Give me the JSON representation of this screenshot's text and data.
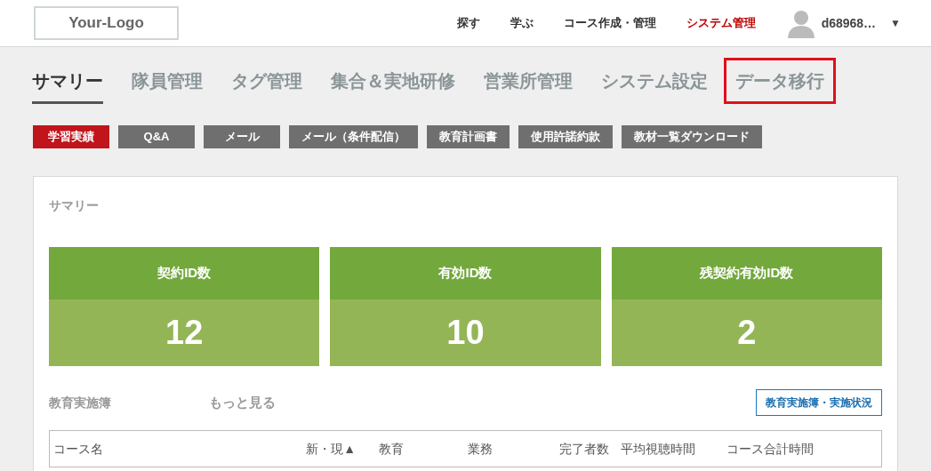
{
  "header": {
    "logo": "Your-Logo",
    "nav": [
      {
        "label": "探す",
        "selected": false
      },
      {
        "label": "学ぶ",
        "selected": false
      },
      {
        "label": "コース作成・管理",
        "selected": false
      },
      {
        "label": "システム管理",
        "selected": true
      }
    ],
    "user": {
      "name": "d68968…",
      "caret": "▼"
    }
  },
  "tabs": [
    {
      "label": "サマリー",
      "selected": true,
      "highlighted": false
    },
    {
      "label": "隊員管理",
      "selected": false,
      "highlighted": false
    },
    {
      "label": "タグ管理",
      "selected": false,
      "highlighted": false
    },
    {
      "label": "集合＆実地研修",
      "selected": false,
      "highlighted": false
    },
    {
      "label": "営業所管理",
      "selected": false,
      "highlighted": false
    },
    {
      "label": "システム設定",
      "selected": false,
      "highlighted": false
    },
    {
      "label": "データ移行",
      "selected": false,
      "highlighted": true
    }
  ],
  "sub_tabs": [
    {
      "label": "学習実績",
      "selected": true
    },
    {
      "label": "Q&A",
      "selected": false
    },
    {
      "label": "メール",
      "selected": false
    },
    {
      "label": "メール（条件配信）",
      "selected": false
    },
    {
      "label": "教育計画書",
      "selected": false
    },
    {
      "label": "使用許諾約款",
      "selected": false
    },
    {
      "label": "教材一覧ダウンロード",
      "selected": false
    }
  ],
  "summary": {
    "title": "サマリー",
    "stats": [
      {
        "label": "契約ID数",
        "value": "12"
      },
      {
        "label": "有効ID数",
        "value": "10"
      },
      {
        "label": "残契約有効ID数",
        "value": "2"
      }
    ]
  },
  "records": {
    "title": "教育実施簿",
    "more_link": "もっと見る",
    "button": "教育実施簿・実施状況",
    "columns": [
      {
        "label": "コース名"
      },
      {
        "label": "新・現▲"
      },
      {
        "label": "教育"
      },
      {
        "label": "業務"
      },
      {
        "label": "完了者数"
      },
      {
        "label": "平均視聴時間"
      },
      {
        "label": "コース合計時間"
      }
    ]
  }
}
